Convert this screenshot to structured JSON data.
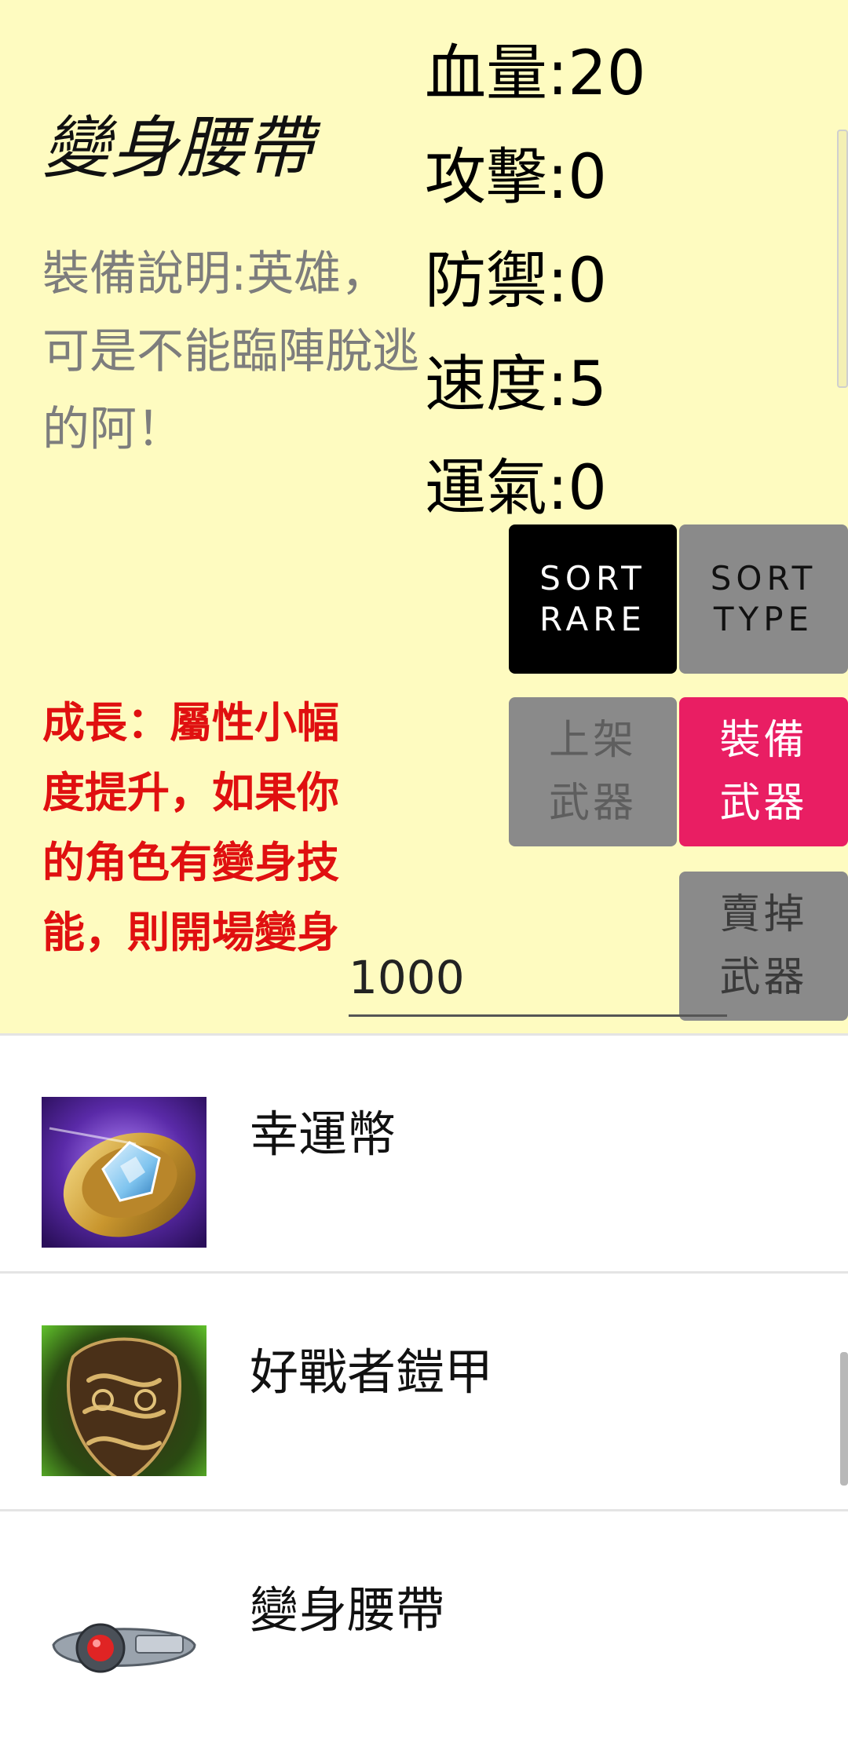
{
  "detail": {
    "name": "變身腰帶",
    "description": "裝備說明:英雄，可是不能臨陣脫逃的阿！",
    "stats": [
      {
        "label": "血量:20"
      },
      {
        "label": "攻擊:0"
      },
      {
        "label": "防禦:0"
      },
      {
        "label": "速度:5"
      },
      {
        "label": "運氣:0"
      }
    ],
    "growth": "成長：屬性小幅度提升，如果你的角色有變身技能，則開場變身",
    "price_value": "1000"
  },
  "buttons": {
    "sort_rare": "SORT\nRARE",
    "sort_type": "SORT\nTYPE",
    "list_weapon": "上架\n武器",
    "equip_weapon": "裝備\n武器",
    "sell_weapon": "賣掉\n武器"
  },
  "items": [
    {
      "name": "幸運幣",
      "icon": "lucky-coin-icon"
    },
    {
      "name": "好戰者鎧甲",
      "icon": "warmonger-armor-icon"
    },
    {
      "name": "變身腰帶",
      "icon": "transform-belt-icon"
    }
  ],
  "colors": {
    "detail_bg": "#fefbc0",
    "growth_text": "#e01010",
    "sort_rare_bg": "#000000",
    "grey_button_bg": "#8a8a8a",
    "equip_button_bg": "#e91e63"
  }
}
